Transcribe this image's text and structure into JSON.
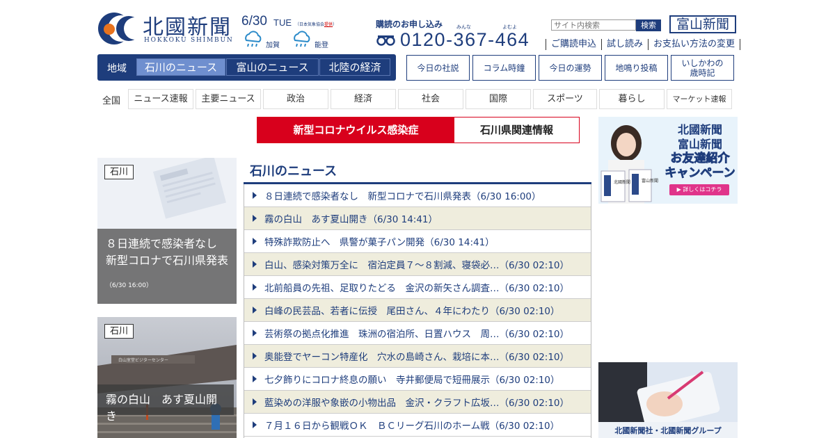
{
  "header": {
    "logo_title": "北國新聞",
    "logo_sub": "HOKKOKU SHIMBUN",
    "date": "6/30",
    "weekday": "TUE",
    "weather_note_prefix": "（日本気象協会",
    "weather_note_link": "提供",
    "weather_note_suffix": "）",
    "weather": [
      {
        "place": "加賀",
        "icon": "rain-cloud-icon"
      },
      {
        "place": "能登",
        "icon": "rain-cloud-icon"
      }
    ],
    "subscribe_title": "購読のお申し込み",
    "ruby_minna": "みんな",
    "ruby_yomu": "よむよ",
    "phone": "0120-367-464",
    "search_placeholder": "サイト内検索",
    "search_button": "検索",
    "toyama_logo": "富山新聞",
    "subscribe_links": [
      "ご購読申込",
      "試し読み",
      "お支払い方法の変更"
    ]
  },
  "region_nav": {
    "label": "地域",
    "tabs": [
      "石川のニュース",
      "富山のニュース",
      "北陸の経済"
    ],
    "active": 0
  },
  "right_buttons": [
    "今日の社説",
    "コラム時鐘",
    "今日の運勢",
    "地鳴り投稿",
    "いしかわの",
    "歳時記"
  ],
  "category_nav": {
    "label": "全国",
    "items": [
      "ニュース速報",
      "主要ニュース",
      "政治",
      "経済",
      "社会",
      "国際",
      "スポーツ",
      "暮らし",
      "マーケット速報"
    ]
  },
  "corona_banner": {
    "left": "新型コロナウイルス感染症",
    "right": "石川県関連情報",
    "accent": "#d8001c"
  },
  "features": [
    {
      "tag": "石川",
      "caption_line1": "８日連続で感染者なし",
      "caption_line2": "新型コロナで石川県発表",
      "time": "（6/30 16:00）"
    },
    {
      "tag": "石川",
      "caption_line1": "霧の白山　あす夏山開き",
      "sign_text": "白山室堂ビジターセンター"
    }
  ],
  "news": {
    "title": "石川のニュース",
    "items": [
      "８日連続で感染者なし　新型コロナで石川県発表（6/30 16:00）",
      "霧の白山　あす夏山開き（6/30 14:41）",
      "特殊詐欺防止へ　県警が菓子パン開発（6/30 14:41）",
      "白山、感染対策万全に　宿泊定員７～８割減、寝袋必…（6/30 02:10）",
      "北前船員の先祖、足取りたどる　金沢の新矢さん調査…（6/30 02:10）",
      "白峰の民芸品、若者に伝授　尾田さん、４年にわたり（6/30 02:10）",
      "芸術祭の拠点化推進　珠洲の宿泊所、日置ハウス　周…（6/30 02:10）",
      "奥能登でヤーコン特産化　穴水の島崎さん、栽培に本…（6/30 02:10）",
      "七夕飾りにコロナ終息の願い　寺井郵便局で短冊展示（6/30 02:10）",
      "藍染めの洋服や象嵌の小物出品　金沢・クラフト広坂…（6/30 02:10）",
      "７月１６日から観戦ＯＫ　ＢＣリーグ石川のホーム戦（6/30 02:10）"
    ]
  },
  "ads": {
    "campaign": {
      "line1": "北國新聞",
      "line2": "富山新聞",
      "line3": "お友達紹介",
      "line4": "キャンペーン",
      "cta": "▶ 詳しくはコチラ",
      "paper1": "北國新聞",
      "paper2": "富山新聞"
    },
    "group": {
      "label": "北國新聞社・北國新聞グループ"
    }
  },
  "colors": {
    "brand": "#1e3d7c",
    "accent_orange": "#e8731e",
    "news_alt_row": "#efeddd"
  }
}
